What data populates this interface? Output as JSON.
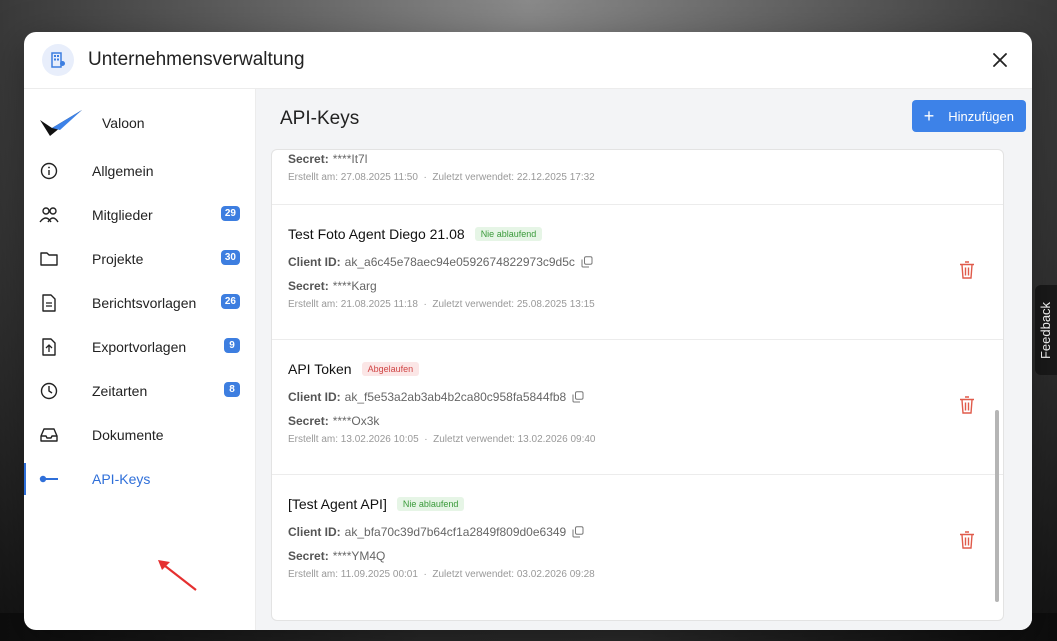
{
  "modal": {
    "title": "Unternehmensverwaltung"
  },
  "sidebar": {
    "brand": "Valoon",
    "items": [
      {
        "label": "Allgemein",
        "icon": "info-icon",
        "badge": null
      },
      {
        "label": "Mitglieder",
        "icon": "users-icon",
        "badge": "29"
      },
      {
        "label": "Projekte",
        "icon": "folder-icon",
        "badge": "30"
      },
      {
        "label": "Berichtsvorlagen",
        "icon": "document-icon",
        "badge": "26"
      },
      {
        "label": "Exportvorlagen",
        "icon": "export-icon",
        "badge": "9"
      },
      {
        "label": "Zeitarten",
        "icon": "clock-icon",
        "badge": "8"
      },
      {
        "label": "Dokumente",
        "icon": "inbox-icon",
        "badge": null
      },
      {
        "label": "API-Keys",
        "icon": "key-icon",
        "badge": null,
        "active": true
      }
    ]
  },
  "main": {
    "title": "API-Keys",
    "add_button": "Hinzufügen"
  },
  "labels": {
    "client_id": "Client ID:",
    "secret": "Secret:",
    "created": "Erstellt am:",
    "last_used": "Zuletzt verwendet:",
    "separator": "·"
  },
  "keys": [
    {
      "name": "",
      "secret": "****It7l",
      "created": "27.08.2025 11:50",
      "last_used": "22.12.2025 17:32"
    },
    {
      "name": "Test Foto Agent Diego 21.08",
      "status": "Nie ablaufend",
      "status_type": "green",
      "client_id": "ak_a6c45e78aec94e0592674822973c9d5c",
      "secret": "****Karg",
      "created": "21.08.2025 11:18",
      "last_used": "25.08.2025 13:15"
    },
    {
      "name": "API Token",
      "status": "Abgelaufen",
      "status_type": "red",
      "client_id": "ak_f5e53a2ab3ab4b2ca80c958fa5844fb8",
      "secret": "****Ox3k",
      "created": "13.02.2026 10:05",
      "last_used": "13.02.2026 09:40"
    },
    {
      "name": "[Test Agent API]",
      "status": "Nie ablaufend",
      "status_type": "green",
      "client_id": "ak_bfa70c39d7b64cf1a2849f809d0e6349",
      "secret": "****YM4Q",
      "created": "11.09.2025 00:01",
      "last_used": "03.02.2026 09:28"
    }
  ],
  "feedback": "Feedback",
  "colors": {
    "accent": "#3d82e8",
    "danger": "#e05a4a",
    "badge": "#3d7ee0"
  }
}
